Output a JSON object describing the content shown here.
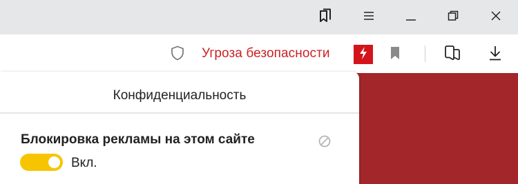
{
  "window": {
    "buttons": [
      "bookmarks-collections",
      "menu",
      "minimize",
      "restore",
      "close"
    ]
  },
  "toolbar": {
    "security_status": "Угроза безопасности",
    "threat_color": "#cc1f24",
    "icons": [
      "shield-icon",
      "turbo-lightning-icon",
      "bookmark-icon",
      "reader-view-icon",
      "download-icon"
    ]
  },
  "popup": {
    "title": "Конфиденциальность",
    "setting": {
      "label": "Блокировка рекламы на этом сайте",
      "toggle_state": "Вкл.",
      "enabled": true,
      "toggle_color": "#f7c500"
    }
  },
  "page": {
    "background_color": "#a3262a"
  }
}
